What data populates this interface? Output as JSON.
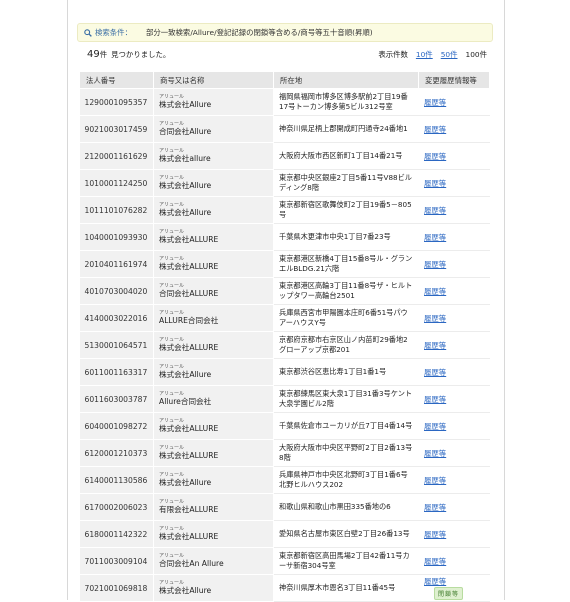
{
  "search": {
    "label": "検索条件：",
    "conditions": "部分一致検索/Allure/登記記録の閉鎖等含める/商号等五十音順(昇順)"
  },
  "results": {
    "count": "49",
    "count_unit": "件",
    "found_text": "見つかりました。",
    "per_page_label": "表示件数",
    "per_page_options": [
      "10件",
      "50件"
    ],
    "per_page_current": "100件"
  },
  "table": {
    "headers": [
      "法人番号",
      "商号又は名称",
      "所在地",
      "変更履歴情報等"
    ],
    "rows": [
      {
        "number": "1290001095357",
        "kana": "アリュール",
        "name": "株式会社Allure",
        "address": "福岡県福岡市博多区博多駅前2丁目19番17号トーカン博多第5ビル312号室",
        "history": "履歴等",
        "badge": ""
      },
      {
        "number": "9021003017459",
        "kana": "アリュール",
        "name": "合同会社Allure",
        "address": "神奈川県足柄上郡開成町円通寺24番地1",
        "history": "履歴等",
        "badge": ""
      },
      {
        "number": "2120001161629",
        "kana": "アリュール",
        "name": "株式会社allure",
        "address": "大阪府大阪市西区新町1丁目14番21号",
        "history": "履歴等",
        "badge": ""
      },
      {
        "number": "1010001124250",
        "kana": "アリュール",
        "name": "株式会社Allure",
        "address": "東京都中央区銀座2丁目5番11号V88ビルディング8階",
        "history": "履歴等",
        "badge": ""
      },
      {
        "number": "1011101076282",
        "kana": "アリュール",
        "name": "株式会社Allure",
        "address": "東京都新宿区歌舞伎町2丁目19番5－805号",
        "history": "履歴等",
        "badge": ""
      },
      {
        "number": "1040001093930",
        "kana": "アリュール",
        "name": "株式会社ALLURE",
        "address": "千葉県木更津市中央1丁目7番23号",
        "history": "履歴等",
        "badge": ""
      },
      {
        "number": "2010401161974",
        "kana": "アリュール",
        "name": "株式会社ALLURE",
        "address": "東京都港区新橋4丁目15番8号ル・グランエルBLDG.21六階",
        "history": "履歴等",
        "badge": ""
      },
      {
        "number": "4010703004020",
        "kana": "アリュール",
        "name": "合同会社ALLURE",
        "address": "東京都港区高輪3丁目11番8号ザ・ヒルトップタワー高輪台2501",
        "history": "履歴等",
        "badge": ""
      },
      {
        "number": "4140003022016",
        "kana": "アリュール",
        "name": "ALLURE合同会社",
        "address": "兵庫県西宮市甲陽園本庄町6番51号パウアーハウスY号",
        "history": "履歴等",
        "badge": ""
      },
      {
        "number": "5130001064571",
        "kana": "アリュール",
        "name": "株式会社ALLURE",
        "address": "京都府京都市右京区山ノ内苗町29番地2グローアップ京都201",
        "history": "履歴等",
        "badge": ""
      },
      {
        "number": "6011001163317",
        "kana": "アリュール",
        "name": "株式会社Allure",
        "address": "東京都渋谷区恵比寿1丁目1番1号",
        "history": "履歴等",
        "badge": ""
      },
      {
        "number": "6011603003787",
        "kana": "アリュール",
        "name": "Allure合同会社",
        "address": "東京都練馬区東大泉1丁目31番3号ケント大泉学園ビル2階",
        "history": "履歴等",
        "badge": ""
      },
      {
        "number": "6040001098272",
        "kana": "アリュール",
        "name": "株式会社ALLURE",
        "address": "千葉県佐倉市ユーカリが丘7丁目4番14号",
        "history": "履歴等",
        "badge": ""
      },
      {
        "number": "6120001210373",
        "kana": "アリュール",
        "name": "株式会社ALLURE",
        "address": "大阪府大阪市中央区平野町2丁目2番13号8階",
        "history": "履歴等",
        "badge": ""
      },
      {
        "number": "6140001130586",
        "kana": "アリュール",
        "name": "株式会社Allure",
        "address": "兵庫県神戸市中央区北野町3丁目1番6号北野ヒルハウス202",
        "history": "履歴等",
        "badge": ""
      },
      {
        "number": "6170002006023",
        "kana": "アリュール",
        "name": "有限会社ALLURE",
        "address": "和歌山県和歌山市黒田335番地の6",
        "history": "履歴等",
        "badge": ""
      },
      {
        "number": "6180001142322",
        "kana": "アリュール",
        "name": "株式会社ALLURE",
        "address": "愛知県名古屋市東区白壁2丁目26番13号",
        "history": "履歴等",
        "badge": ""
      },
      {
        "number": "7011003009104",
        "kana": "アリュール",
        "name": "合同会社An Allure",
        "address": "東京都新宿区高田馬場2丁目42番11号カーサ新宿304号室",
        "history": "履歴等",
        "badge": ""
      },
      {
        "number": "7021001069818",
        "kana": "アリュール",
        "name": "株式会社Allure",
        "address": "神奈川県厚木市恩名3丁目11番45号",
        "history": "履歴等",
        "badge": "閉鎖等"
      }
    ]
  }
}
